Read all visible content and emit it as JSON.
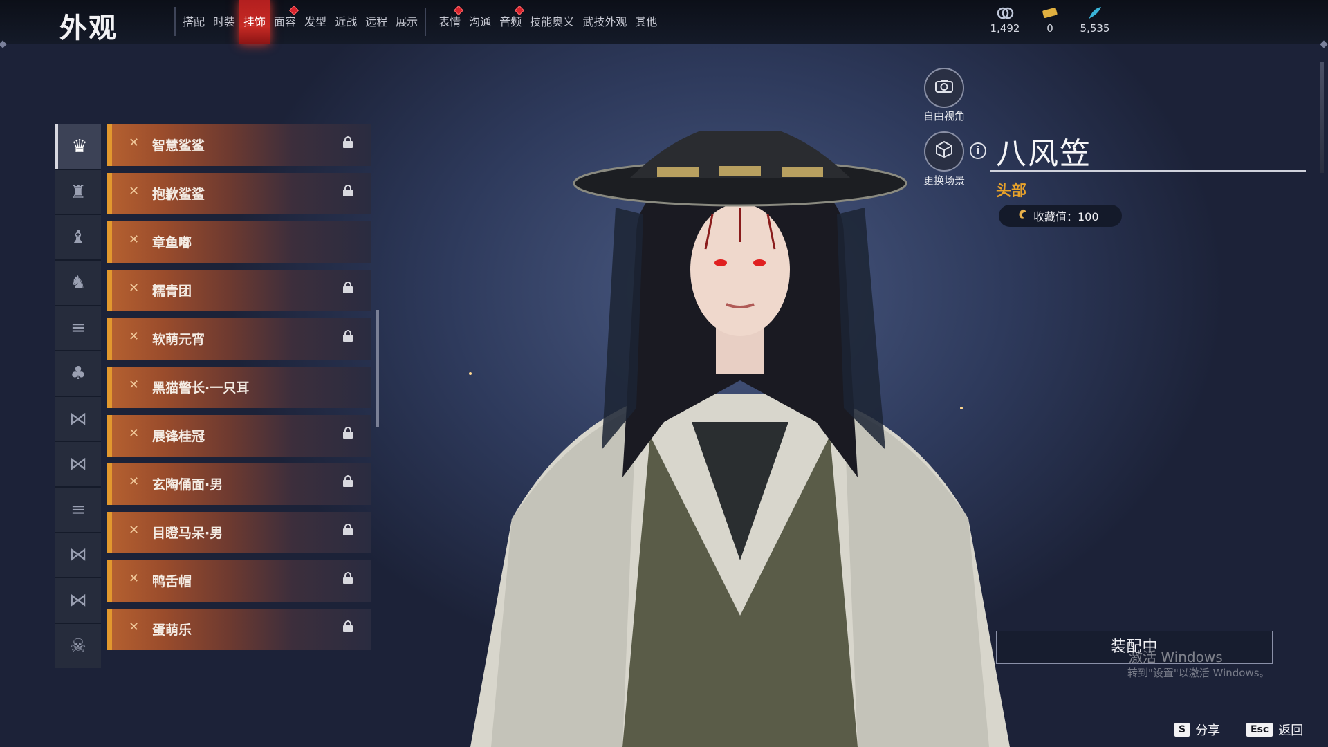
{
  "page_title": "外观",
  "tabs": [
    {
      "label": "搭配",
      "active": false,
      "badge": false
    },
    {
      "label": "时装",
      "active": false,
      "badge": false
    },
    {
      "label": "挂饰",
      "active": true,
      "badge": false
    },
    {
      "label": "面容",
      "active": false,
      "badge": true
    },
    {
      "label": "发型",
      "active": false,
      "badge": false
    },
    {
      "label": "近战",
      "active": false,
      "badge": false
    },
    {
      "label": "远程",
      "active": false,
      "badge": false
    },
    {
      "label": "展示",
      "active": false,
      "badge": false
    },
    {
      "label": "表情",
      "active": false,
      "badge": true
    },
    {
      "label": "沟通",
      "active": false,
      "badge": false
    },
    {
      "label": "音频",
      "active": false,
      "badge": true
    },
    {
      "label": "技能奥义",
      "active": false,
      "badge": false
    },
    {
      "label": "武技外观",
      "active": false,
      "badge": false
    },
    {
      "label": "其他",
      "active": false,
      "badge": false
    }
  ],
  "currencies": [
    {
      "icon": "coin-icon",
      "value": "1,492"
    },
    {
      "icon": "ticket-icon",
      "value": "0"
    },
    {
      "icon": "feather-icon",
      "value": "5,535"
    }
  ],
  "categories": [
    {
      "icon": "head-ornament-icon",
      "active": true
    },
    {
      "icon": "face-ornament-icon",
      "active": false
    },
    {
      "icon": "hairpin-icon",
      "active": false
    },
    {
      "icon": "figure-icon",
      "active": false
    },
    {
      "icon": "shoulder-icon",
      "active": false
    },
    {
      "icon": "cloak-icon",
      "active": false
    },
    {
      "icon": "bow-icon",
      "active": false
    },
    {
      "icon": "waist-icon",
      "active": false
    },
    {
      "icon": "hat-icon",
      "active": false
    },
    {
      "icon": "ribbon-icon",
      "active": false
    },
    {
      "icon": "wing-icon",
      "active": false
    },
    {
      "icon": "mask-icon",
      "active": false
    }
  ],
  "items": [
    {
      "name": "智慧鲨鲨",
      "locked": true
    },
    {
      "name": "抱歉鲨鲨",
      "locked": true
    },
    {
      "name": "章鱼嘟",
      "locked": false
    },
    {
      "name": "糯青团",
      "locked": true
    },
    {
      "name": "软萌元宵",
      "locked": true
    },
    {
      "name": "黑猫警长·一只耳",
      "locked": false
    },
    {
      "name": "展锋桂冠",
      "locked": true
    },
    {
      "name": "玄陶俑面·男",
      "locked": true
    },
    {
      "name": "目瞪马呆·男",
      "locked": true
    },
    {
      "name": "鸭舌帽",
      "locked": true
    },
    {
      "name": "蛋萌乐",
      "locked": true
    }
  ],
  "free_view_label": "自由视角",
  "change_scene_label": "更换场景",
  "selected_item": {
    "title": "八风笠",
    "slot": "头部",
    "collection_text": "收藏值：100"
  },
  "equip_label": "装配中",
  "watermark": {
    "line1": "激活 Windows",
    "line2": "转到\"设置\"以激活 Windows。"
  },
  "hints": [
    {
      "key": "S",
      "label": "分享"
    },
    {
      "key": "Esc",
      "label": "返回"
    }
  ]
}
